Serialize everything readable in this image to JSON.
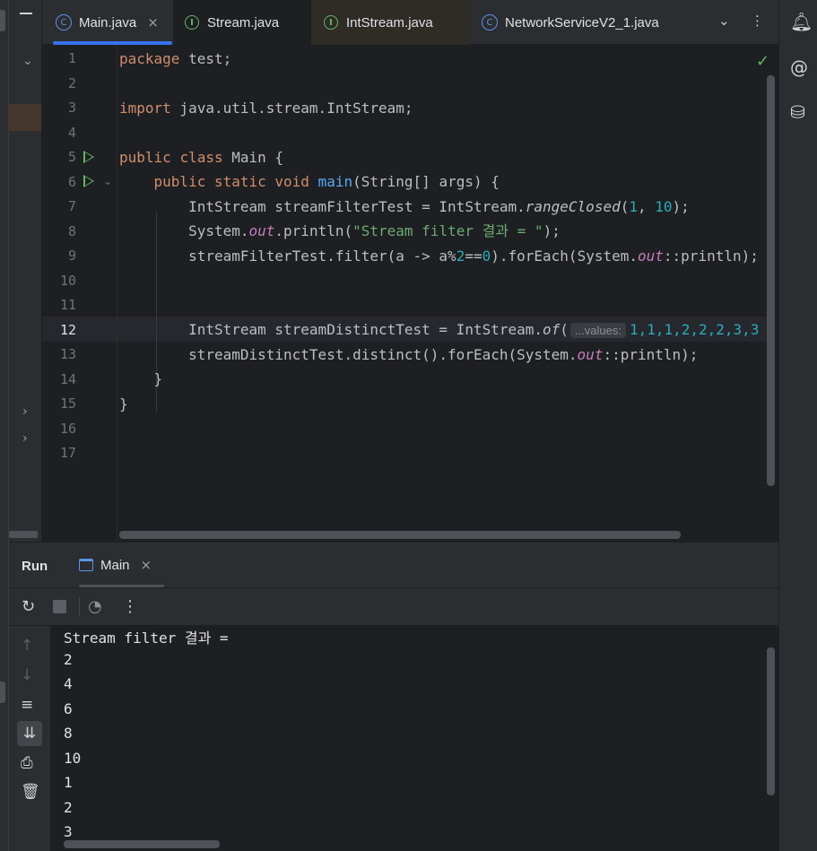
{
  "tabs": [
    {
      "label": "Main.java",
      "icon": "class-icon",
      "active": true,
      "closable": true
    },
    {
      "label": "Stream.java",
      "icon": "interface-icon"
    },
    {
      "label": "IntStream.java",
      "icon": "interface-icon"
    },
    {
      "label": "NetworkServiceV2_1.java",
      "icon": "class-icon"
    }
  ],
  "editor": {
    "line_numbers": [
      "1",
      "2",
      "3",
      "4",
      "5",
      "6",
      "7",
      "8",
      "9",
      "10",
      "11",
      "12",
      "13",
      "14",
      "15",
      "16",
      "17"
    ],
    "current_line": "12",
    "lines": {
      "l1": {
        "kw": "package",
        "rest": " test;"
      },
      "l3": {
        "kw": "import",
        "rest": " java.util.stream.IntStream;"
      },
      "l5": {
        "kw1": "public",
        "kw2": "class",
        "rest": " Main {"
      },
      "l6": {
        "indent": "    ",
        "kw1": "public",
        "kw2": "static",
        "kw3": "void",
        "fn": "main",
        "rest": "(String[] args) {"
      },
      "l7": {
        "a": "        IntStream streamFilterTest = IntStream.",
        "m": "rangeClosed",
        "b": "(",
        "n1": "1",
        "c": ", ",
        "n2": "10",
        "d": ");"
      },
      "l8": {
        "a": "        System.",
        "f": "out",
        "b": ".println(",
        "s": "\"Stream filter 결과 = \"",
        "c": ");"
      },
      "l9": {
        "a": "        streamFilterTest.filter(a -> a%",
        "n1": "2",
        "b": "==",
        "n2": "0",
        "c": ").forEach(System.",
        "f": "out",
        "d": "::println);"
      },
      "l12": {
        "a": "        IntStream streamDistinctTest = IntStream.",
        "m": "of",
        "b": "(",
        "hint": "...values:",
        "vals": "1,1,1,2,2,2,3,3"
      },
      "l13": {
        "a": "        streamDistinctTest.distinct().forEach(System.",
        "f": "out",
        "b": "::println);"
      },
      "l14": {
        "a": "    }"
      },
      "l15": {
        "a": "}"
      }
    }
  },
  "run": {
    "title": "Run",
    "tab_label": "Main",
    "output": [
      "Stream filter 결과 =",
      "2",
      "4",
      "6",
      "8",
      "10",
      "1",
      "2",
      "3"
    ]
  }
}
